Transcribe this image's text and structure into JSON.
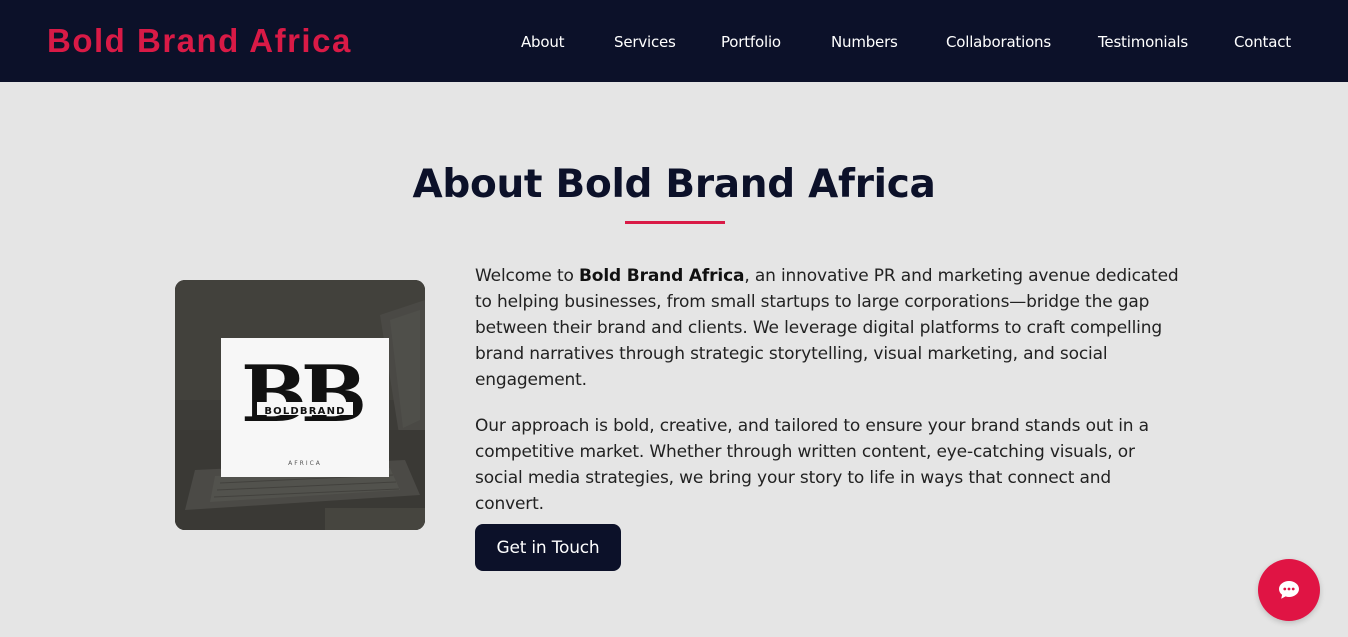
{
  "header": {
    "brand": "Bold Brand Africa",
    "nav": [
      "About",
      "Services",
      "Portfolio",
      "Numbers",
      "Collaborations",
      "Testimonials",
      "Contact"
    ]
  },
  "about": {
    "title": "About Bold Brand Africa",
    "logo": {
      "letters": "BB",
      "wordmark": "BOLDBRAND",
      "sub": "AFRICA"
    },
    "para1": {
      "prefix": "Welcome to ",
      "bold": "Bold Brand Africa",
      "rest": ", an innovative PR and marketing avenue dedicated to helping businesses, from small startups to large corporations—bridge the gap between their brand and clients. We leverage digital platforms to craft compelling brand narratives through strategic storytelling, visual marketing, and social engagement."
    },
    "para2": "Our approach is bold, creative, and tailored to ensure your brand stands out in a competitive market. Whether through written content, eye-catching visuals, or social media strategies, we bring your story to life in ways that connect and convert.",
    "cta": "Get in Touch"
  },
  "chat": {
    "icon": "chat-bubble-icon"
  },
  "colors": {
    "navy": "#0c1129",
    "accent": "#d91a46",
    "background": "#e5e5e5"
  }
}
